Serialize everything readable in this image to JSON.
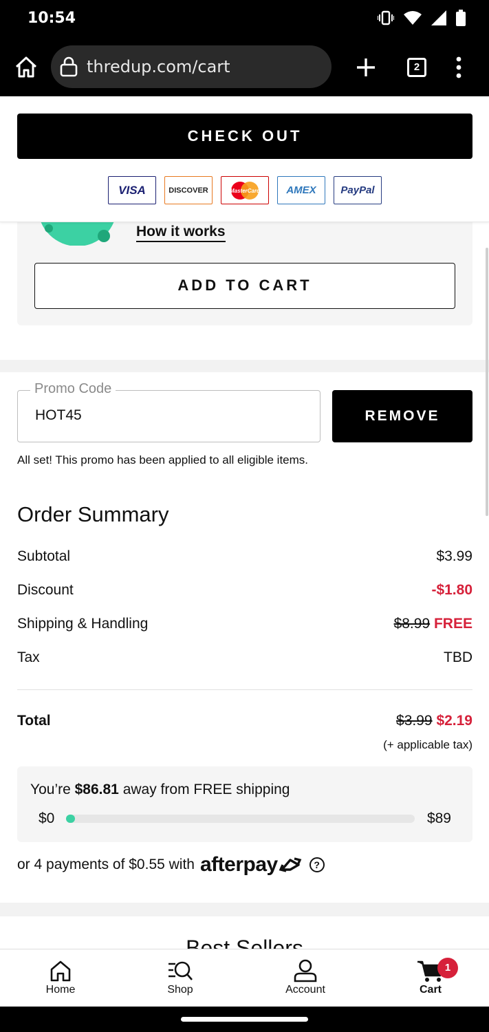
{
  "status_bar": {
    "time": "10:54"
  },
  "browser": {
    "url": "thredup.com/cart",
    "tab_count": "2"
  },
  "sticky": {
    "checkout_label": "CHECK OUT",
    "payment_cards": [
      "VISA",
      "DISCOVER",
      "MasterCard",
      "AMEX",
      "PayPal"
    ]
  },
  "panel": {
    "how_it_works": "How it works",
    "add_to_cart": "ADD TO CART"
  },
  "promo": {
    "label": "Promo Code",
    "value": "HOT45",
    "remove_label": "REMOVE",
    "message": "All set! This promo has been applied to all eligible items."
  },
  "summary": {
    "title": "Order Summary",
    "subtotal_label": "Subtotal",
    "subtotal_value": "$3.99",
    "discount_label": "Discount",
    "discount_value": "-$1.80",
    "shipping_label": "Shipping & Handling",
    "shipping_original": "$8.99",
    "shipping_value": "FREE",
    "tax_label": "Tax",
    "tax_value": "TBD",
    "total_label": "Total",
    "total_original": "$3.99",
    "total_value": "$2.19",
    "tax_note": "(+ applicable tax)"
  },
  "free_shipping": {
    "prefix": "You’re",
    "amount": "$86.81",
    "suffix": "away from FREE shipping",
    "min_label": "$0",
    "max_label": "$89",
    "progress_percent": 2.5
  },
  "afterpay": {
    "text": "or 4 payments of $0.55 with",
    "logo": "afterpay",
    "help": "?"
  },
  "best_sellers": {
    "title": "Best Sellers"
  },
  "nav": {
    "home": "Home",
    "shop": "Shop",
    "account": "Account",
    "cart": "Cart",
    "cart_count": "1"
  },
  "colors": {
    "accent_red": "#d6213a",
    "progress_green": "#3cd1a3"
  }
}
